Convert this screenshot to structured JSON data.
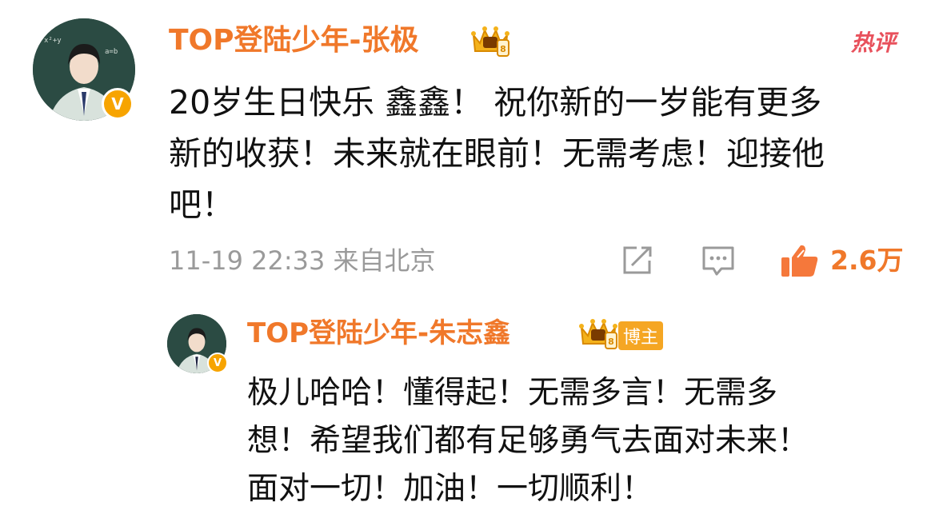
{
  "comment": {
    "username": "TOP登陆少年-张极",
    "hot_tag": "热评",
    "lines": [
      "20岁生日快乐 鑫鑫！ 祝你新的一岁能有更多",
      "新的收获！未来就在眼前！无需考虑！迎接他",
      "吧！"
    ],
    "timestamp": "11-19 22:33 来自北京",
    "likes": "2.6万",
    "verified_badge": "V"
  },
  "reply": {
    "username": "TOP登陆少年-朱志鑫",
    "tag": "博主",
    "lines": [
      "极儿哈哈！懂得起！无需多言！无需多",
      "想！希望我们都有足够勇气去面对未来！",
      "面对一切！加油！一切顺利！"
    ],
    "verified_badge": "V"
  },
  "colors": {
    "username": "#f0782a",
    "meta": "#9a9a9a",
    "hot_tag": "#e8515c",
    "badge": "#f7a400"
  },
  "icons": [
    "crown-badge-icon",
    "share-icon",
    "comment-icon",
    "like-icon",
    "verified-icon"
  ]
}
